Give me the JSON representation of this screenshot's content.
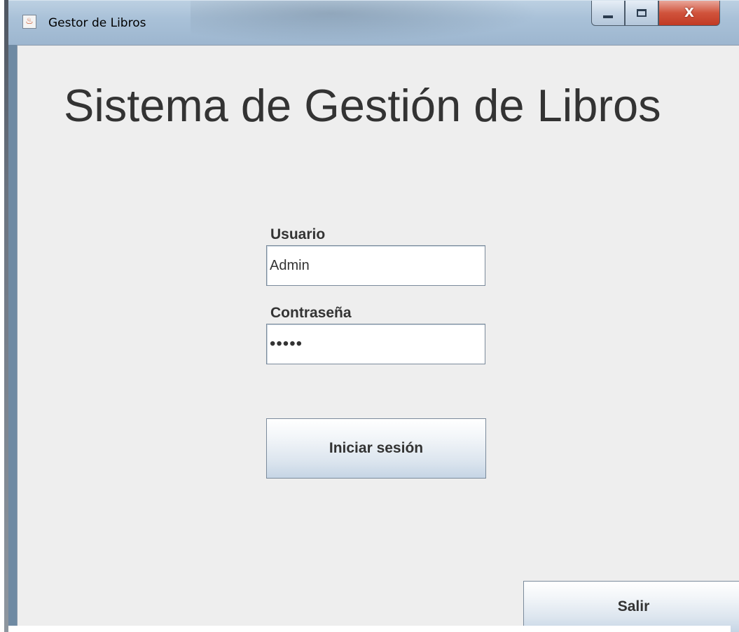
{
  "window": {
    "title": "Gestor de Libros",
    "icon": "java-coffee-icon",
    "controls": {
      "minimize_icon": "minimize-icon",
      "maximize_icon": "maximize-icon",
      "close_label": "X"
    }
  },
  "main": {
    "heading": "Sistema de Gestión de Libros",
    "username_label": "Usuario",
    "username_value": "Admin",
    "password_label": "Contraseña",
    "password_value": "•••••",
    "login_button": "Iniciar sesión",
    "exit_button": "Salir"
  },
  "colors": {
    "client_background": "#eeeeee",
    "text": "#333333",
    "close_button": "#c94a33"
  }
}
